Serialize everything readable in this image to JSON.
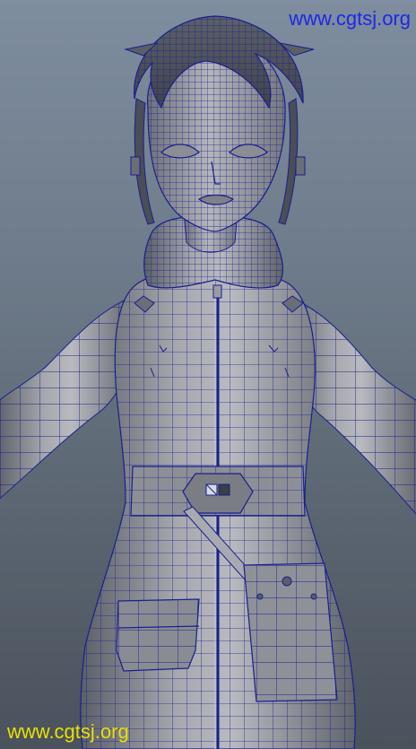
{
  "watermarks": {
    "top_right": "www.cgtsj.org",
    "bottom_left": "www.cgtsj.org"
  },
  "colors": {
    "background_top": "#7e8d9f",
    "background_bottom": "#4a525c",
    "mesh_wire": "#1a1f8f",
    "model_shading": "#9a9ca2",
    "watermark_top": "#1e28e6",
    "watermark_bottom": "#e8e000"
  },
  "scene": {
    "subject": "wireframe-character-model",
    "icons": [
      "zipper-icon",
      "belt-buckle-icon",
      "pouch-icon",
      "pocket-icon"
    ]
  }
}
